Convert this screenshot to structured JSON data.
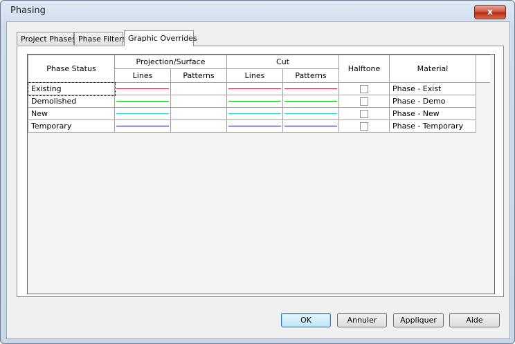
{
  "window": {
    "title": "Phasing",
    "close_glyph": "x"
  },
  "tabs": [
    {
      "label": "Project Phases",
      "active": false
    },
    {
      "label": "Phase Filters",
      "active": false
    },
    {
      "label": "Graphic Overrides",
      "active": true
    }
  ],
  "table": {
    "headers": {
      "phase_status": "Phase Status",
      "projection_surface": "Projection/Surface",
      "cut": "Cut",
      "halftone": "Halftone",
      "material": "Material",
      "lines": "Lines",
      "patterns": "Patterns"
    },
    "rows": [
      {
        "status": "Existing",
        "material": "Phase - Exist",
        "color": "#c8102e",
        "halftone": false
      },
      {
        "status": "Demolished",
        "material": "Phase - Demo",
        "color": "#00c000",
        "halftone": false
      },
      {
        "status": "New",
        "material": "Phase - New",
        "color": "#20d0d0",
        "halftone": false
      },
      {
        "status": "Temporary",
        "material": "Phase - Temporary",
        "color": "#00008b",
        "halftone": false
      }
    ]
  },
  "buttons": {
    "ok": "OK",
    "cancel": "Annuler",
    "apply": "Appliquer",
    "help": "Aide"
  }
}
